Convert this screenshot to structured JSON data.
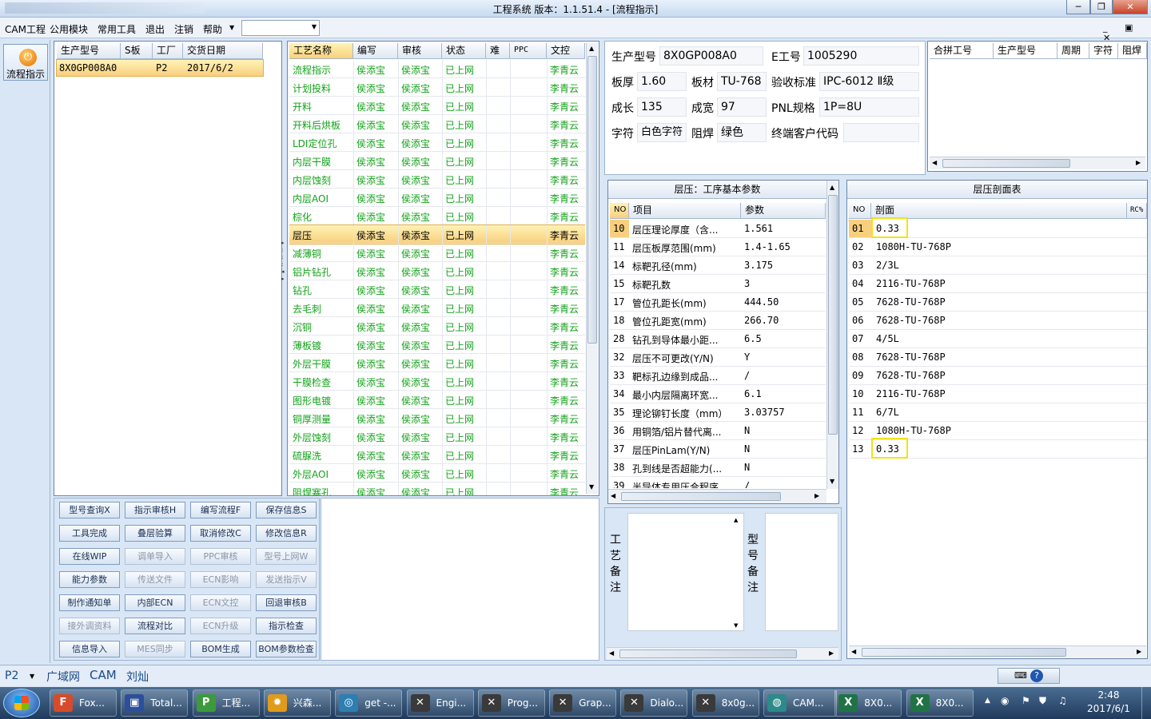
{
  "window": {
    "title": "工程系统   版本：1.1.51.4 - [流程指示]"
  },
  "menu": {
    "items": [
      "CAM工程",
      "公用模块",
      "常用工具",
      "退出",
      "注销",
      "帮助"
    ],
    "combo_value": ""
  },
  "left_nav": {
    "flow_button": "流程指示"
  },
  "product_table": {
    "headers": [
      "生产型号",
      "S板",
      "工厂",
      "交货日期"
    ],
    "rows": [
      {
        "model": "8X0GP008A0",
        "s": "",
        "factory": "P2",
        "date": "2017/6/2"
      }
    ]
  },
  "process_table": {
    "headers": [
      "工艺名称",
      "编写",
      "审核",
      "状态",
      "难",
      "PPC",
      "文控"
    ],
    "rows": [
      [
        "流程指示",
        "侯添宝",
        "侯添宝",
        "已上网",
        "",
        "",
        "李青云"
      ],
      [
        "计划投料",
        "侯添宝",
        "侯添宝",
        "已上网",
        "",
        "",
        "李青云"
      ],
      [
        "开料",
        "侯添宝",
        "侯添宝",
        "已上网",
        "",
        "",
        "李青云"
      ],
      [
        "开料后烘板",
        "侯添宝",
        "侯添宝",
        "已上网",
        "",
        "",
        "李青云"
      ],
      [
        "LDI定位孔",
        "侯添宝",
        "侯添宝",
        "已上网",
        "",
        "",
        "李青云"
      ],
      [
        "内层干膜",
        "侯添宝",
        "侯添宝",
        "已上网",
        "",
        "",
        "李青云"
      ],
      [
        "内层蚀刻",
        "侯添宝",
        "侯添宝",
        "已上网",
        "",
        "",
        "李青云"
      ],
      [
        "内层AOI",
        "侯添宝",
        "侯添宝",
        "已上网",
        "",
        "",
        "李青云"
      ],
      [
        "棕化",
        "侯添宝",
        "侯添宝",
        "已上网",
        "",
        "",
        "李青云"
      ],
      [
        "层压",
        "侯添宝",
        "侯添宝",
        "已上网",
        "",
        "",
        "李青云"
      ],
      [
        "减薄铜",
        "侯添宝",
        "侯添宝",
        "已上网",
        "",
        "",
        "李青云"
      ],
      [
        "铝片钻孔",
        "侯添宝",
        "侯添宝",
        "已上网",
        "",
        "",
        "李青云"
      ],
      [
        "钻孔",
        "侯添宝",
        "侯添宝",
        "已上网",
        "",
        "",
        "李青云"
      ],
      [
        "去毛刺",
        "侯添宝",
        "侯添宝",
        "已上网",
        "",
        "",
        "李青云"
      ],
      [
        "沉铜",
        "侯添宝",
        "侯添宝",
        "已上网",
        "",
        "",
        "李青云"
      ],
      [
        "薄板镀",
        "侯添宝",
        "侯添宝",
        "已上网",
        "",
        "",
        "李青云"
      ],
      [
        "外层干膜",
        "侯添宝",
        "侯添宝",
        "已上网",
        "",
        "",
        "李青云"
      ],
      [
        "干膜检查",
        "侯添宝",
        "侯添宝",
        "已上网",
        "",
        "",
        "李青云"
      ],
      [
        "图形电镀",
        "侯添宝",
        "侯添宝",
        "已上网",
        "",
        "",
        "李青云"
      ],
      [
        "铜厚测量",
        "侯添宝",
        "侯添宝",
        "已上网",
        "",
        "",
        "李青云"
      ],
      [
        "外层蚀刻",
        "侯添宝",
        "侯添宝",
        "已上网",
        "",
        "",
        "李青云"
      ],
      [
        "硫脲洗",
        "侯添宝",
        "侯添宝",
        "已上网",
        "",
        "",
        "李青云"
      ],
      [
        "外层AOI",
        "侯添宝",
        "侯添宝",
        "已上网",
        "",
        "",
        "李青云"
      ],
      [
        "阻焊塞孔",
        "侯添宝",
        "侯添宝",
        "已上网",
        "",
        "",
        "李青云"
      ]
    ],
    "selected_index": 9
  },
  "func_buttons": [
    {
      "label": "型号查询X",
      "enabled": true
    },
    {
      "label": "指示审核H",
      "enabled": true
    },
    {
      "label": "编写流程F",
      "enabled": true
    },
    {
      "label": "保存信息S",
      "enabled": true
    },
    {
      "label": "工具完成",
      "enabled": true
    },
    {
      "label": "叠层验算",
      "enabled": true
    },
    {
      "label": "取消修改C",
      "enabled": true
    },
    {
      "label": "修改信息R",
      "enabled": true
    },
    {
      "label": "在线WIP",
      "enabled": true
    },
    {
      "label": "调单导入",
      "enabled": false
    },
    {
      "label": "PPC审核",
      "enabled": false
    },
    {
      "label": "型号上网W",
      "enabled": false
    },
    {
      "label": "能力参数",
      "enabled": true
    },
    {
      "label": "传送文件",
      "enabled": false
    },
    {
      "label": "ECN影响",
      "enabled": false
    },
    {
      "label": "发送指示V",
      "enabled": false
    },
    {
      "label": "制作通知单",
      "enabled": true
    },
    {
      "label": "内部ECN",
      "enabled": true
    },
    {
      "label": "ECN文控",
      "enabled": false
    },
    {
      "label": "回退审核B",
      "enabled": true
    },
    {
      "label": "接外调资料",
      "enabled": false
    },
    {
      "label": "流程对比",
      "enabled": true
    },
    {
      "label": "ECN升级",
      "enabled": false
    },
    {
      "label": "指示检查",
      "enabled": true
    },
    {
      "label": "信息导入",
      "enabled": true
    },
    {
      "label": "MES同步",
      "enabled": false
    },
    {
      "label": "BOM生成",
      "enabled": true
    },
    {
      "label": "BOM参数检查",
      "enabled": true
    }
  ],
  "info": {
    "model_label": "生产型号",
    "model": "8X0GP008A0",
    "eno_label": "E工号",
    "eno": "1005290",
    "thick_label": "板厚",
    "thick": "1.60",
    "material_label": "板材",
    "material": "TU-768",
    "std_label": "验收标准",
    "std": "IPC-6012 Ⅱ级",
    "length_label": "成长",
    "length": "135",
    "width_label": "成宽",
    "width": "97",
    "pnl_label": "PNL规格",
    "pnl": "1P=8U",
    "char_label": "字符",
    "char": "白色字符",
    "mask_label": "阻焊",
    "mask": "绿色",
    "cust_label": "终端客户代码",
    "cust": ""
  },
  "merge_table": {
    "headers": [
      "合拼工号",
      "生产型号",
      "周期",
      "字符",
      "阻焊"
    ]
  },
  "params": {
    "title": "层压：工序基本参数",
    "headers": [
      "NO",
      "项目",
      "参数"
    ],
    "rows": [
      [
        "10",
        "层压理论厚度（含...",
        "1.561"
      ],
      [
        "11",
        "层压板厚范围(mm)",
        "1.4-1.65"
      ],
      [
        "14",
        "标靶孔径(mm)",
        "3.175"
      ],
      [
        "15",
        "标靶孔数",
        "3"
      ],
      [
        "17",
        "管位孔距长(mm)",
        "444.50"
      ],
      [
        "18",
        "管位孔距宽(mm)",
        "266.70"
      ],
      [
        "28",
        "钻孔到导体最小距...",
        "6.5"
      ],
      [
        "32",
        "层压不可更改(Y/N)",
        "Y"
      ],
      [
        "33",
        "靶标孔边缘到成品...",
        "/"
      ],
      [
        "34",
        "最小内层隔离环宽...",
        "6.1"
      ],
      [
        "35",
        "理论铆钉长度（mm）",
        "3.03757"
      ],
      [
        "36",
        "用铜箔/铝片替代离...",
        "N"
      ],
      [
        "37",
        "层压PinLam(Y/N)",
        "N"
      ],
      [
        "38",
        "孔到线是否超能力(...",
        "N"
      ],
      [
        "39",
        "半导体专用压合程序",
        "/"
      ]
    ]
  },
  "stack": {
    "title": "层压剖面表",
    "headers": [
      "NO",
      "剖面",
      "RC%"
    ],
    "rows": [
      [
        "01",
        "0.33"
      ],
      [
        "02",
        "1080H-TU-768P"
      ],
      [
        "03",
        "2/3L"
      ],
      [
        "04",
        "2116-TU-768P"
      ],
      [
        "05",
        "7628-TU-768P"
      ],
      [
        "06",
        "7628-TU-768P"
      ],
      [
        "07",
        "4/5L"
      ],
      [
        "08",
        "7628-TU-768P"
      ],
      [
        "09",
        "7628-TU-768P"
      ],
      [
        "10",
        "2116-TU-768P"
      ],
      [
        "11",
        "6/7L"
      ],
      [
        "12",
        "1080H-TU-768P"
      ],
      [
        "13",
        "0.33"
      ]
    ]
  },
  "notes": {
    "process_note": "工艺备注",
    "model_note": "型号备注"
  },
  "statusbar": {
    "factory": "P2",
    "items": [
      "广域网",
      "CAM",
      "刘灿"
    ]
  },
  "taskbar": {
    "items": [
      "Fox...",
      "Total...",
      "工程...",
      "兴森...",
      "get -...",
      "Engi...",
      "Prog...",
      "Grap...",
      "Dialo...",
      "8x0g...",
      "CAM...",
      "8X0...",
      "8X0..."
    ],
    "time": "2:48",
    "date": "2017/6/1"
  },
  "colors": {
    "accent": "#f8cf7e",
    "status_green": "#13a21a",
    "highlight_box": "#f2e21b"
  }
}
